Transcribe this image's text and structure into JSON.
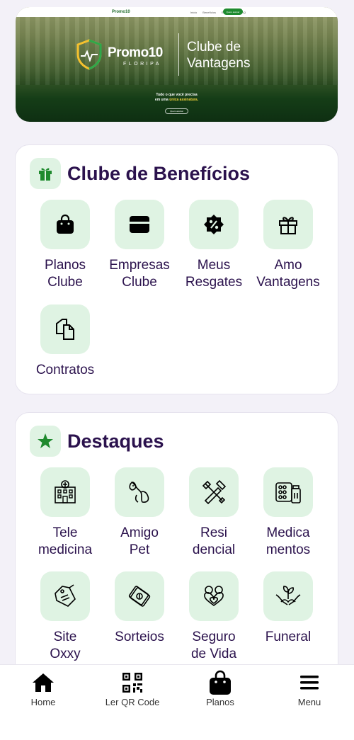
{
  "banner": {
    "brand_word": "Promo10",
    "brand_sub": "FLORIPA",
    "club_line1": "Clube de",
    "club_line2": "Vantagens",
    "tagline_a": "Tudo o que você precisa",
    "tagline_b_prefix": "em uma",
    "tagline_b_highlight": "única assinatura.",
    "mini_logo": "Promo10",
    "mini_nav": [
      "Início",
      "Benefícios",
      "Empresas",
      "FAQ"
    ],
    "mini_button": "Quero assinar"
  },
  "beneficios": {
    "title": "Clube de Benefícios",
    "items": [
      {
        "line1": "Planos",
        "line2": "Clube",
        "icon": "shopping-bag-icon"
      },
      {
        "line1": "Empresas",
        "line2": "Clube",
        "icon": "storefront-icon"
      },
      {
        "line1": "Meus",
        "line2": "Resgates",
        "icon": "discount-badge-icon"
      },
      {
        "line1": "Amo",
        "line2": "Vantagens",
        "icon": "gift-icon"
      },
      {
        "line1": "Contratos",
        "line2": "",
        "icon": "documents-icon"
      }
    ]
  },
  "destaques": {
    "title": "Destaques",
    "items": [
      {
        "line1": "Tele",
        "line2": "medicina",
        "icon": "hospital-icon"
      },
      {
        "line1": "Amigo",
        "line2": "Pet",
        "icon": "pet-icon"
      },
      {
        "line1": "Resi",
        "line2": "dencial",
        "icon": "tools-icon"
      },
      {
        "line1": "Medica",
        "line2": "mentos",
        "icon": "pills-icon"
      },
      {
        "line1": "Site",
        "line2": "Oxxy",
        "icon": "tag-icon"
      },
      {
        "line1": "Sorteios",
        "line2": "",
        "icon": "money-icon"
      },
      {
        "line1": "Seguro",
        "line2": "de Vida",
        "icon": "heart-hands-icon"
      },
      {
        "line1": "Funeral",
        "line2": "",
        "icon": "plant-hands-icon"
      }
    ]
  },
  "tabbar": {
    "home": "Home",
    "qr": "Ler QR Code",
    "planos": "Planos",
    "menu": "Menu"
  },
  "colors": {
    "accent_green": "#1f8a2e",
    "title_purple": "#2b124d",
    "icon_bg": "#dff3e3"
  }
}
